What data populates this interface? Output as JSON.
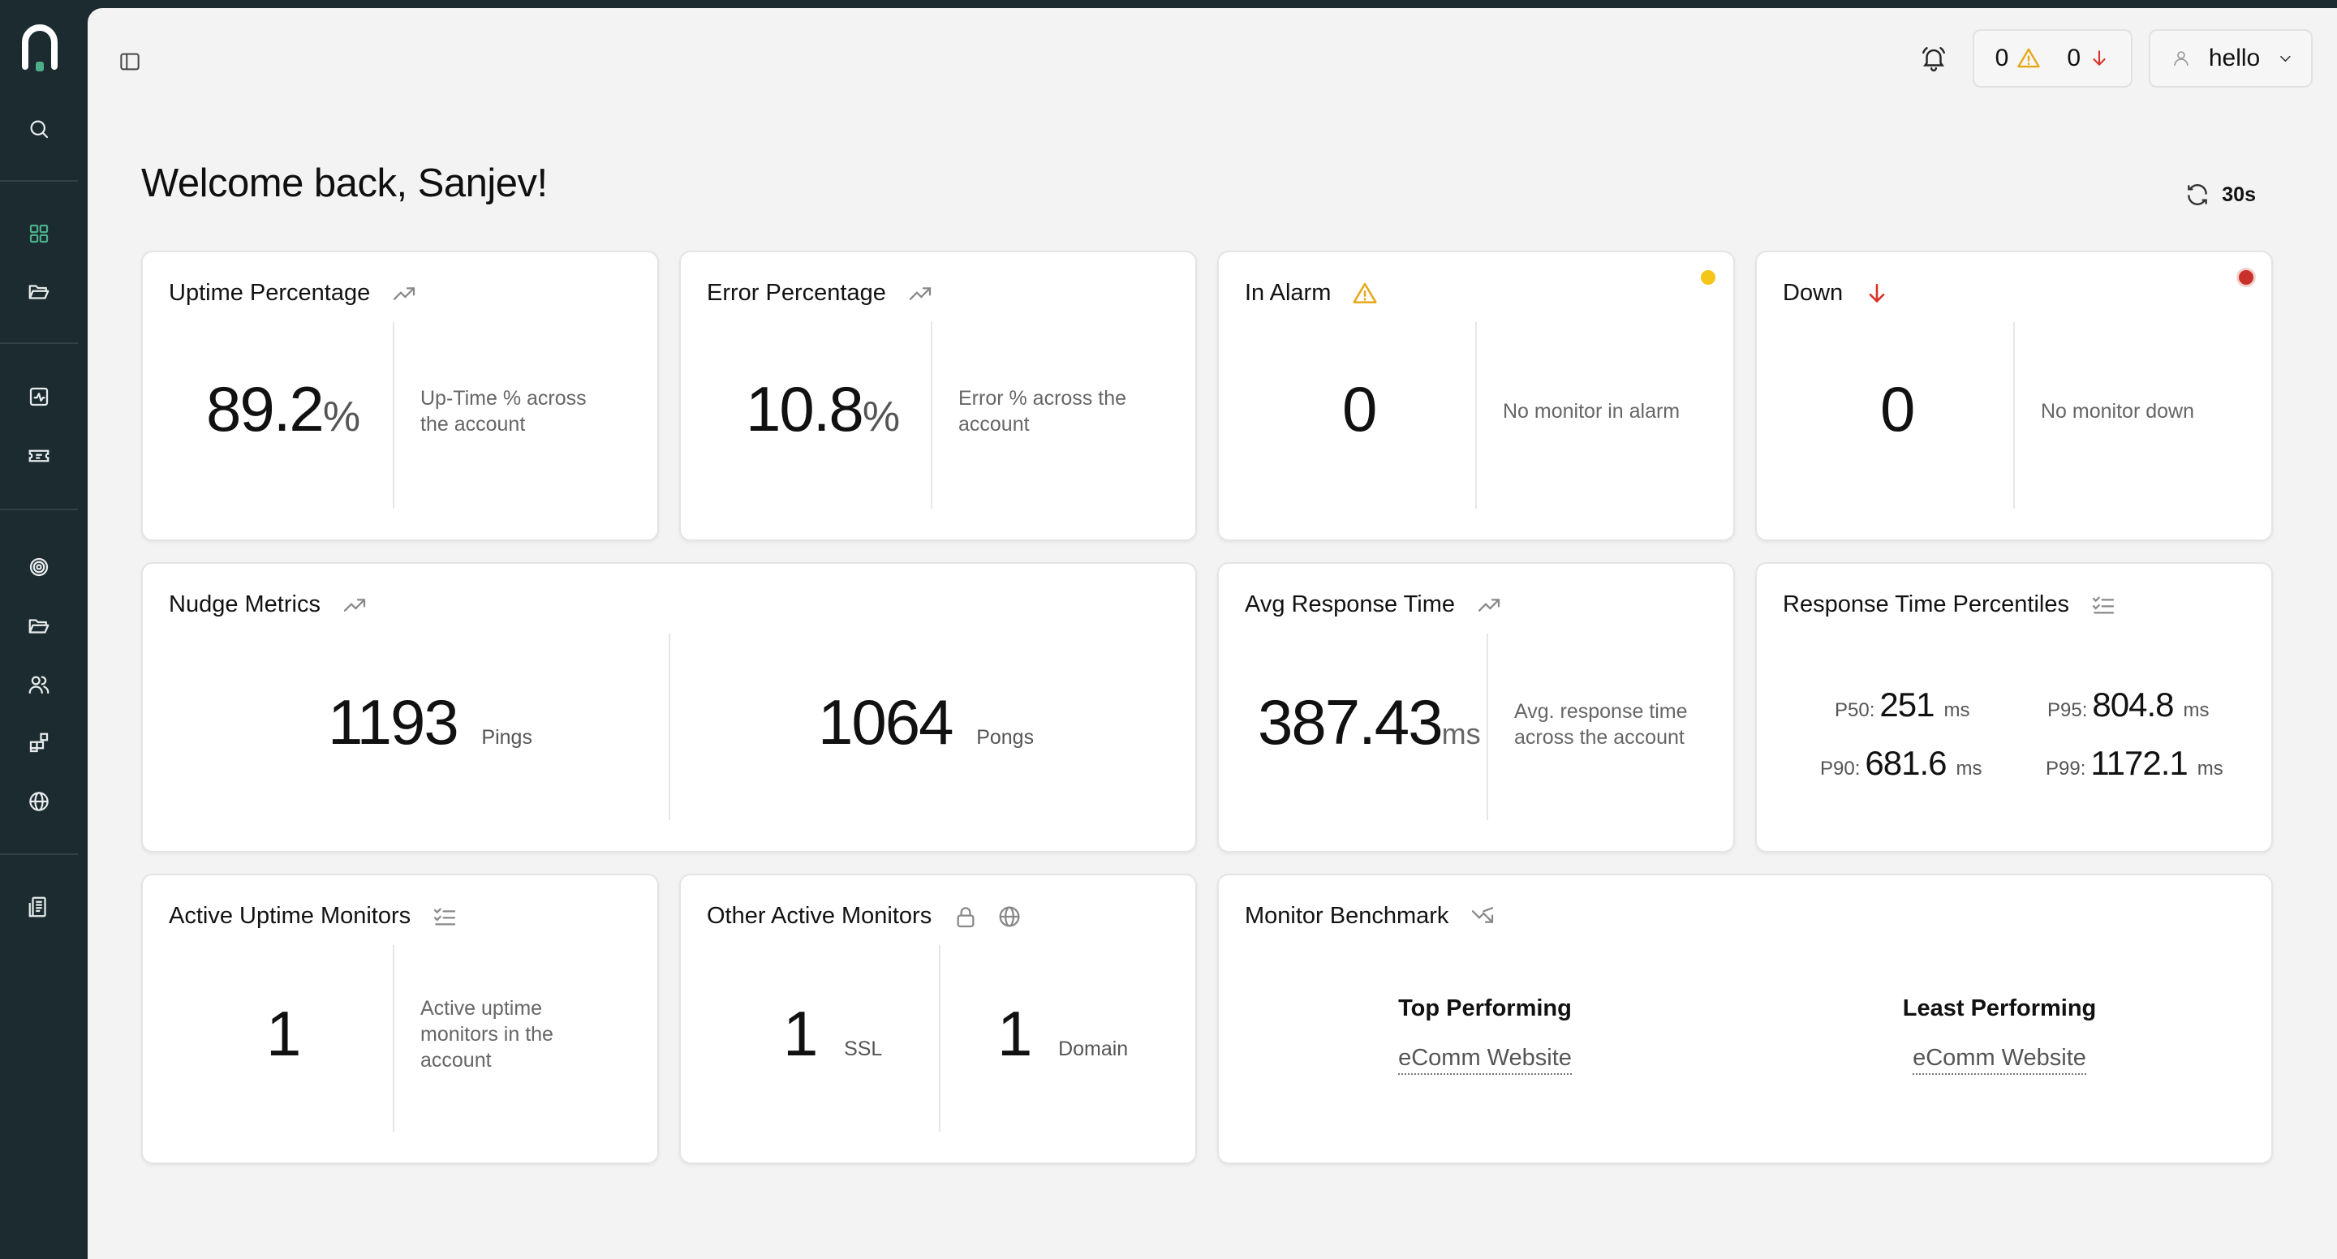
{
  "header": {
    "warning_count": "0",
    "down_count": "0",
    "user_name": "hello"
  },
  "welcome": "Welcome back, Sanjev!",
  "refresh_interval": "30s",
  "cards": {
    "uptime": {
      "title": "Uptime Percentage",
      "value": "89.2",
      "unit": "%",
      "desc": "Up-Time % across the account"
    },
    "error": {
      "title": "Error Percentage",
      "value": "10.8",
      "unit": "%",
      "desc": "Error % across the account"
    },
    "alarm": {
      "title": "In Alarm",
      "value": "0",
      "desc": "No monitor in alarm",
      "dot_color": "#f5c518"
    },
    "down": {
      "title": "Down",
      "value": "0",
      "desc": "No monitor down",
      "dot_color": "#c9302c"
    },
    "nudge": {
      "title": "Nudge Metrics",
      "pings": "1193",
      "pings_label": "Pings",
      "pongs": "1064",
      "pongs_label": "Pongs"
    },
    "avg_response": {
      "title": "Avg Response Time",
      "value": "387.43",
      "unit": "ms",
      "desc": "Avg. response time across the account"
    },
    "percentiles": {
      "title": "Response Time Percentiles",
      "p50_label": "P50:",
      "p50": "251",
      "p95_label": "P95:",
      "p95": "804.8",
      "p90_label": "P90:",
      "p90": "681.6",
      "p99_label": "P99:",
      "p99": "1172.1",
      "unit": "ms"
    },
    "active_uptime": {
      "title": "Active Uptime Monitors",
      "value": "1",
      "desc": "Active uptime monitors in the account"
    },
    "other_active": {
      "title": "Other Active Monitors",
      "ssl": "1",
      "ssl_label": "SSL",
      "domain": "1",
      "domain_label": "Domain"
    },
    "benchmark": {
      "title": "Monitor Benchmark",
      "top_label": "Top Performing",
      "top_monitor": "eComm Website",
      "least_label": "Least Performing",
      "least_monitor": "eComm Website"
    }
  },
  "colors": {
    "sidebar_bg": "#1b2b30",
    "accent_green": "#4caf8a",
    "warning": "#e6a817",
    "danger": "#d9342b"
  }
}
